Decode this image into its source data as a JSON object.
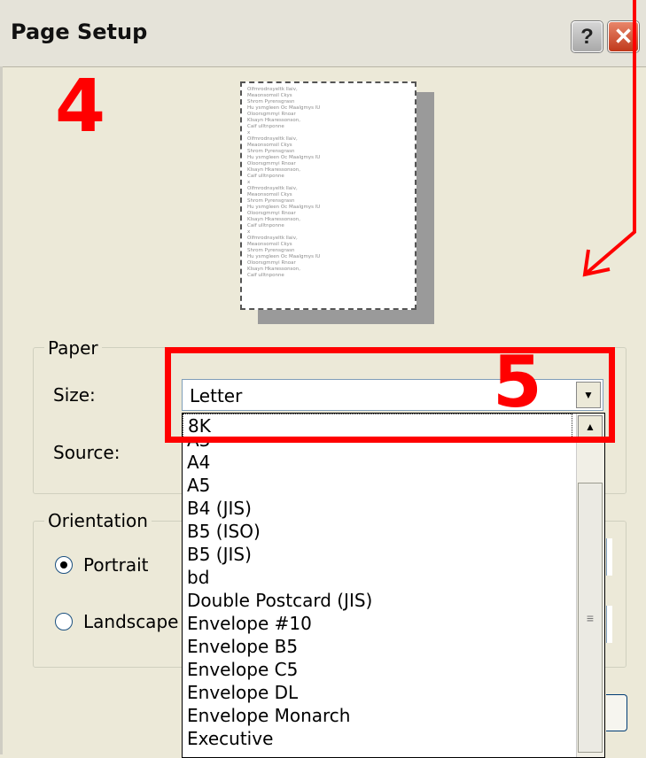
{
  "window": {
    "title": "Page Setup",
    "help_glyph": "?",
    "close_glyph": "✕"
  },
  "annotations": {
    "step_a": "4",
    "step_b": "5",
    "color": "#ff0000"
  },
  "paper": {
    "group_label": "Paper",
    "size_label": "Size:",
    "source_label": "Source:",
    "size_value": "Letter",
    "size_options": [
      "8K",
      "A3",
      "A4",
      "A5",
      "B4 (JIS)",
      "B5 (ISO)",
      "B5 (JIS)",
      "bd",
      "Double Postcard (JIS)",
      "Envelope #10",
      "Envelope B5",
      "Envelope C5",
      "Envelope DL",
      "Envelope Monarch",
      "Executive"
    ]
  },
  "orientation": {
    "group_label": "Orientation",
    "portrait_label": "Portrait",
    "landscape_label": "Landscape",
    "selected": "Portrait"
  },
  "icons": {
    "combo_arrow": "chevron-down-icon",
    "scroll_up": "chevron-up-icon",
    "close": "close-icon",
    "help": "help-icon"
  }
}
